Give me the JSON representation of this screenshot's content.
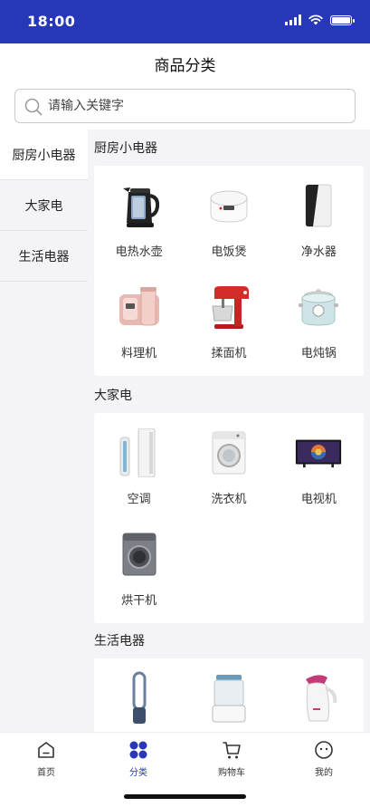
{
  "status_bar": {
    "time": "18:00"
  },
  "header": {
    "title": "商品分类"
  },
  "search": {
    "placeholder": "请输入关键字"
  },
  "sidebar": {
    "items": [
      {
        "label": "厨房小电器",
        "active": true
      },
      {
        "label": "大家电",
        "active": false
      },
      {
        "label": "生活电器",
        "active": false
      }
    ]
  },
  "sections": [
    {
      "title": "厨房小电器",
      "products": [
        {
          "name": "电热水壶",
          "icon": "kettle-icon"
        },
        {
          "name": "电饭煲",
          "icon": "rice-cooker-icon"
        },
        {
          "name": "净水器",
          "icon": "water-purifier-icon"
        },
        {
          "name": "料理机",
          "icon": "blender-icon"
        },
        {
          "name": "揉面机",
          "icon": "stand-mixer-icon"
        },
        {
          "name": "电炖锅",
          "icon": "stew-pot-icon"
        }
      ]
    },
    {
      "title": "大家电",
      "products": [
        {
          "name": "空调",
          "icon": "air-conditioner-icon"
        },
        {
          "name": "洗衣机",
          "icon": "washing-machine-icon"
        },
        {
          "name": "电视机",
          "icon": "tv-icon"
        },
        {
          "name": "烘干机",
          "icon": "dryer-icon"
        }
      ]
    },
    {
      "title": "生活电器",
      "products": [
        {
          "name": "",
          "icon": "bladeless-fan-icon"
        },
        {
          "name": "",
          "icon": "humidifier-icon"
        },
        {
          "name": "",
          "icon": "garment-steamer-icon"
        }
      ]
    }
  ],
  "tabbar": {
    "items": [
      {
        "label": "首页",
        "icon": "home-icon",
        "active": false
      },
      {
        "label": "分类",
        "icon": "category-icon",
        "active": true
      },
      {
        "label": "购物车",
        "icon": "cart-icon",
        "active": false
      },
      {
        "label": "我的",
        "icon": "profile-icon",
        "active": false
      }
    ]
  },
  "colors": {
    "accent": "#2637b8",
    "background": "#f4f4f6"
  }
}
